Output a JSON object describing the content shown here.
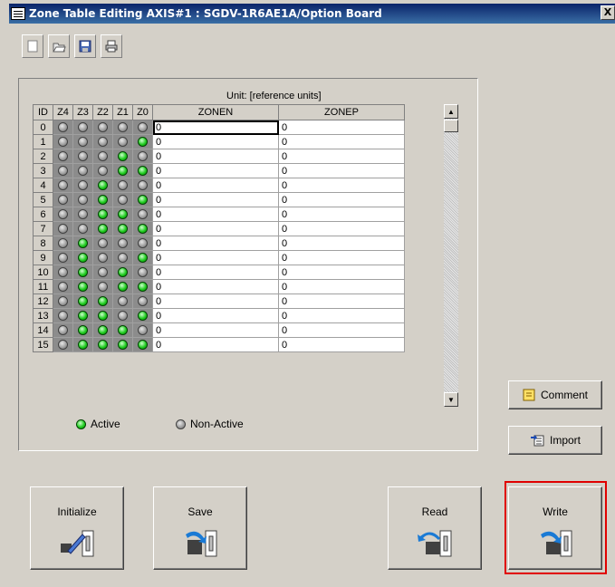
{
  "window": {
    "title": "Zone Table Editing AXIS#1 : SGDV-1R6AE1A/Option Board",
    "close": "X"
  },
  "toolbar": {
    "icons": [
      "new-icon",
      "open-icon",
      "save-file-icon",
      "print-icon"
    ]
  },
  "table": {
    "unit_label": "Unit:  [reference units]",
    "headers": [
      "ID",
      "Z4",
      "Z3",
      "Z2",
      "Z1",
      "Z0",
      "ZONEN",
      "ZONEP"
    ],
    "rows": [
      {
        "id": "0",
        "zonen": "0",
        "zonep": "0"
      },
      {
        "id": "1",
        "zonen": "0",
        "zonep": "0"
      },
      {
        "id": "2",
        "zonen": "0",
        "zonep": "0"
      },
      {
        "id": "3",
        "zonen": "0",
        "zonep": "0"
      },
      {
        "id": "4",
        "zonen": "0",
        "zonep": "0"
      },
      {
        "id": "5",
        "zonen": "0",
        "zonep": "0"
      },
      {
        "id": "6",
        "zonen": "0",
        "zonep": "0"
      },
      {
        "id": "7",
        "zonen": "0",
        "zonep": "0"
      },
      {
        "id": "8",
        "zonen": "0",
        "zonep": "0"
      },
      {
        "id": "9",
        "zonen": "0",
        "zonep": "0"
      },
      {
        "id": "10",
        "zonen": "0",
        "zonep": "0"
      },
      {
        "id": "11",
        "zonen": "0",
        "zonep": "0"
      },
      {
        "id": "12",
        "zonen": "0",
        "zonep": "0"
      },
      {
        "id": "13",
        "zonen": "0",
        "zonep": "0"
      },
      {
        "id": "14",
        "zonen": "0",
        "zonep": "0"
      },
      {
        "id": "15",
        "zonen": "0",
        "zonep": "0"
      }
    ]
  },
  "legend": {
    "active": "Active",
    "inactive": "Non-Active"
  },
  "side_buttons": {
    "comment": "Comment",
    "import": "Import"
  },
  "actions": {
    "initialize": "Initialize",
    "save": "Save",
    "read": "Read",
    "write": "Write"
  },
  "colors": {
    "active_led": "#22cc22",
    "inactive_led": "#9a9a9a",
    "highlight": "#e00000"
  }
}
